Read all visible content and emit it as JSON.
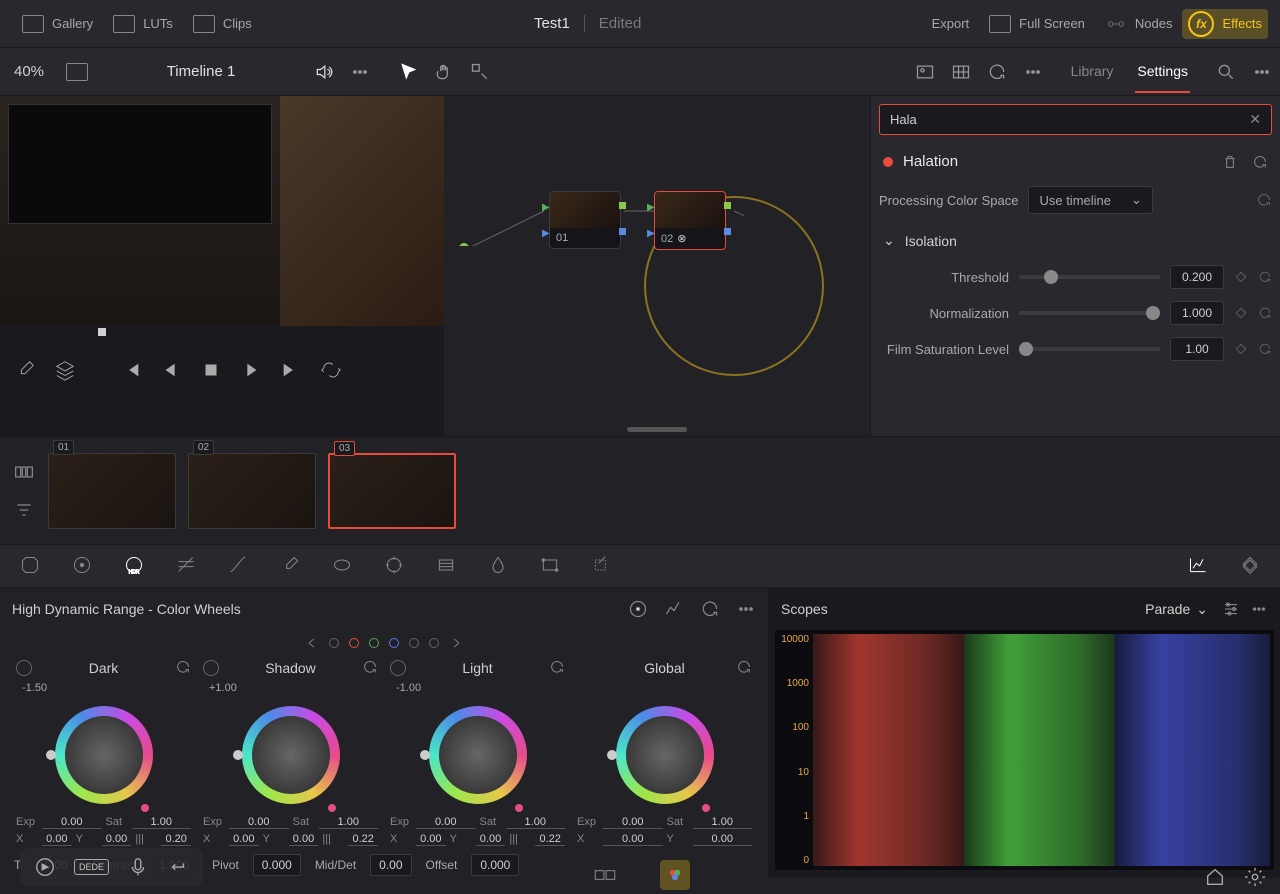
{
  "topbar": {
    "gallery": "Gallery",
    "luts": "LUTs",
    "clips": "Clips",
    "title": "Test1",
    "status": "Edited",
    "export": "Export",
    "fullscreen": "Full Screen",
    "nodes": "Nodes",
    "effects": "Effects",
    "fx_glyph": "fx"
  },
  "row2": {
    "zoom": "40%",
    "timeline": "Timeline 1",
    "tabs": {
      "library": "Library",
      "settings": "Settings"
    }
  },
  "nodes": {
    "n1": "01",
    "n2": "02"
  },
  "settings": {
    "search": "Hala",
    "fx_name": "Halation",
    "pcs_label": "Processing Color Space",
    "pcs_value": "Use timeline",
    "section": "Isolation",
    "params": {
      "threshold": {
        "label": "Threshold",
        "value": "0.200"
      },
      "normalization": {
        "label": "Normalization",
        "value": "1.000"
      },
      "film_sat": {
        "label": "Film Saturation Level",
        "value": "1.00"
      }
    }
  },
  "clips": {
    "c1": "01",
    "c2": "02",
    "c3": "03"
  },
  "wheels": {
    "title": "High Dynamic Range - Color Wheels",
    "dark": {
      "name": "Dark",
      "exp": "-1.50"
    },
    "shadow": {
      "name": "Shadow",
      "exp": "+1.00"
    },
    "light": {
      "name": "Light",
      "exp": "-1.00"
    },
    "global": {
      "name": "Global"
    },
    "labels": {
      "exp": "Exp",
      "sat": "Sat",
      "x": "X",
      "y": "Y",
      "h": "|||"
    },
    "vals": {
      "exp0": "0.00",
      "sat1": "1.00",
      "x0": "0.00",
      "y0": "0.00",
      "h020": "0.20",
      "h022": "0.22"
    }
  },
  "globals": {
    "temp": "T",
    "tempval": "0.00",
    "contrast": "Contrast",
    "contrastval": "1.000",
    "pivot": "Pivot",
    "pivotval": "0.000",
    "middet": "Mid/Det",
    "middetval": "0.00",
    "offset": "Offset",
    "offsetval": "0.000"
  },
  "scopes": {
    "title": "Scopes",
    "mode": "Parade",
    "axis": [
      "10000",
      "1000",
      "100",
      "10",
      "1",
      "0"
    ]
  },
  "dock": {
    "dede": "DEDE"
  }
}
